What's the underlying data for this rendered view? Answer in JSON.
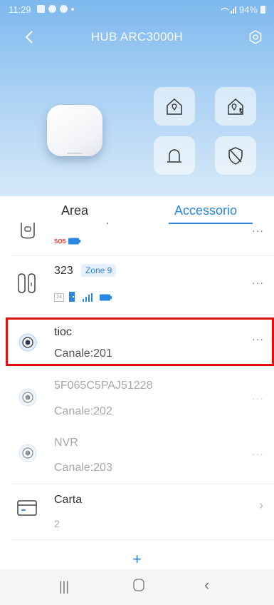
{
  "status_bar": {
    "time": "11:29",
    "battery": "94%"
  },
  "header": {
    "title": "HUB ARC3000H"
  },
  "modes": {
    "icons": [
      "home-arm-icon",
      "home-stay-icon",
      "alarm-bell-icon",
      "disarm-shield-icon"
    ]
  },
  "tabs": [
    {
      "label": "Area",
      "active": false
    },
    {
      "label": "Accessorio",
      "active": true
    }
  ],
  "accessories": [
    {
      "name": "",
      "badge": "SOS"
    },
    {
      "name": "323",
      "zone": "Zone 9",
      "number_badge": "24"
    },
    {
      "name": "tioc",
      "channel": "Canale:201"
    },
    {
      "name": "5F065C5PAJ51228",
      "channel": "Canale:202"
    },
    {
      "name": "NVR",
      "channel": "Canale:203"
    },
    {
      "name": "Carta",
      "count": "2"
    }
  ],
  "colors": {
    "accent": "#2b86e0",
    "highlight": "#e31010"
  }
}
